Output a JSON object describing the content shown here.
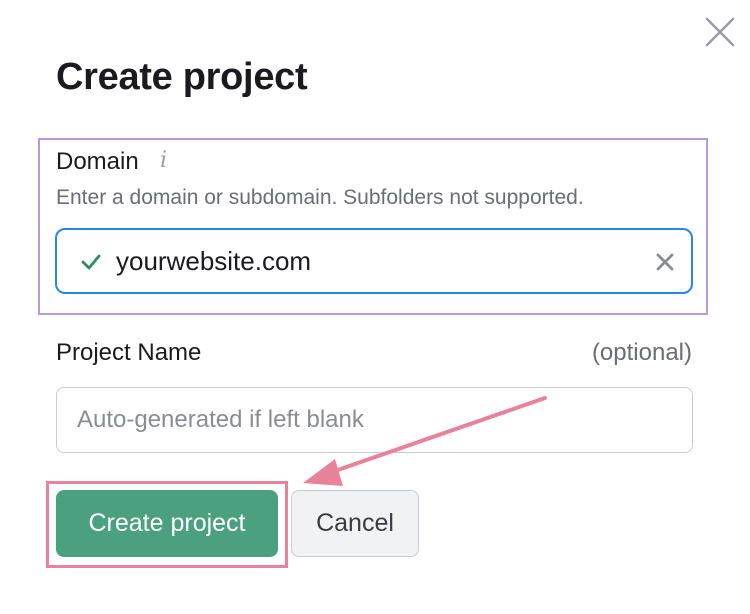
{
  "dialog": {
    "title": "Create project",
    "close_icon": "close-icon"
  },
  "domain": {
    "label": "Domain",
    "info_icon": "info-icon",
    "info_glyph": "i",
    "hint": "Enter a domain or subdomain. Subfolders not supported.",
    "value": "yourwebsite.com",
    "valid_icon": "check-icon",
    "clear_icon": "clear-icon"
  },
  "project_name": {
    "label": "Project Name",
    "optional_text": "(optional)",
    "placeholder": "Auto-generated if left blank",
    "value": ""
  },
  "actions": {
    "create_label": "Create project",
    "cancel_label": "Cancel"
  },
  "colors": {
    "primary_button": "#4aa07f",
    "domain_highlight": "#b69ae0",
    "button_highlight": "#e8829a",
    "annotation_arrow": "#e8829a",
    "field_focus": "#2e82e8",
    "valid_check": "#2f8a60"
  }
}
